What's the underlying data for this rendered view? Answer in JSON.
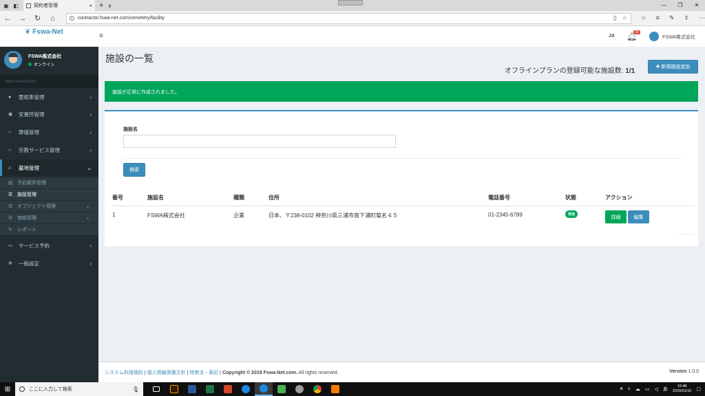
{
  "browser": {
    "tab_title": "契約者管理",
    "url": "contractor.fswa-net.com/cemetery/facility"
  },
  "header": {
    "brand": "Fswa-Net",
    "language": "JA",
    "notification_count": "10",
    "user_name": "FSWA株式会社"
  },
  "sidebar": {
    "company": "FSWA株式会社",
    "status": "オンライン",
    "section_header": "MAIN NAVIGATION",
    "items": [
      {
        "label": "霊柩車管理",
        "icon": "car-icon"
      },
      {
        "label": "安置所管理",
        "icon": "globe-icon"
      },
      {
        "label": "葬儀管理",
        "icon": "home-icon"
      },
      {
        "label": "宗教サービス管理",
        "icon": "home-icon"
      },
      {
        "label": "墓地管理",
        "icon": "home-icon",
        "active": true
      }
    ],
    "subitems": [
      {
        "label": "予約案件管理",
        "icon": "printer-icon"
      },
      {
        "label": "施設管理",
        "icon": "list-icon",
        "current": true
      },
      {
        "label": "オブジェクト管理",
        "icon": "list-icon"
      },
      {
        "label": "価格管理",
        "icon": "list-icon"
      },
      {
        "label": "レポート",
        "icon": "edit-icon"
      }
    ],
    "bottom_items": [
      {
        "label": "サービス予約",
        "icon": "cart-icon"
      },
      {
        "label": "一般設定",
        "icon": "gear-icon"
      }
    ]
  },
  "main": {
    "title": "施設の一覧",
    "plan_text": "オフラインプランの登録可能な施設数:",
    "plan_count": "1/1",
    "add_button": "新規施設追加",
    "alert": "施設が正常に作成されました。",
    "filter_label": "施設名",
    "filter_value": "",
    "search_button": "検索",
    "table": {
      "headers": [
        "番号",
        "施設名",
        "種類",
        "住所",
        "電話番号",
        "状態",
        "アクション"
      ],
      "rows": [
        {
          "no": "1",
          "name": "FSWA株式会社",
          "type": "企業",
          "address": "日本、〒238-0102 神奈川県三浦市南下浦町菊名４５",
          "phone": "01-2345-6789",
          "status": "有効",
          "detail_button": "詳細",
          "edit_button": "編集"
        }
      ]
    }
  },
  "footer": {
    "link1": "システム利用規約",
    "link2": "個人情報保護方針",
    "link3": "特商法・表記",
    "copyright_label": "Copyright © 2019 Fswa-Net.com.",
    "rights": "All rights reserved.",
    "version_label": "Version",
    "version": "1.0.0"
  },
  "taskbar": {
    "search_placeholder": "ここに入力して検索",
    "time": "15:48",
    "date": "2020/01/10"
  }
}
